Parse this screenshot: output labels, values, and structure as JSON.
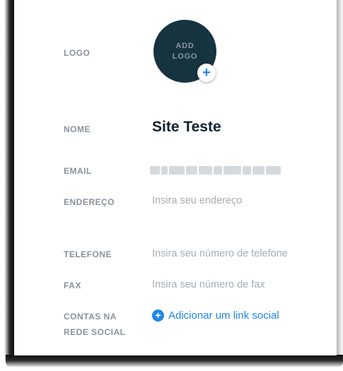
{
  "fields": {
    "logo_label": "LOGO",
    "logo_placeholder": "ADD LOGO",
    "logo_add_icon": "plus-icon",
    "name_label": "NOME",
    "name_value": "Site Teste",
    "email_label": "EMAIL",
    "address_label": "ENDEREÇO",
    "address_placeholder": "Insira seu endereço",
    "phone_label": "TELEFONE",
    "phone_placeholder": "Insira seu número de telefone",
    "fax_label": "FAX",
    "fax_placeholder": "Insira seu número de fax",
    "social_label_line1": "CONTAS NA",
    "social_label_line2": "REDE SOCIAL",
    "social_add_label": "Adicionar um link social",
    "social_add_icon": "plus-circle-icon"
  },
  "colors": {
    "accent": "#1e86e6",
    "logo_bg": "#163340",
    "label": "#8a9199",
    "placeholder": "#a6adb5",
    "title": "#13232d"
  }
}
